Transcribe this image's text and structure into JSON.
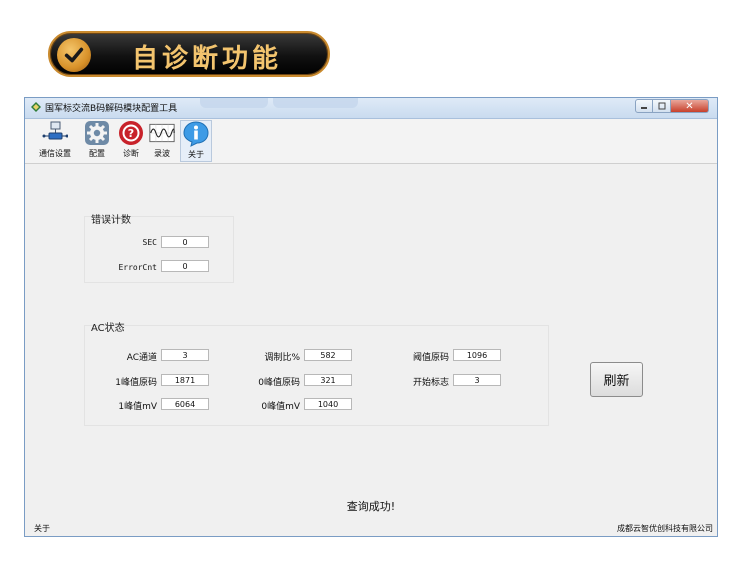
{
  "banner": {
    "title": "自诊断功能",
    "accent": "#f3c46e"
  },
  "window": {
    "title": "国军标交流B码解码模块配置工具",
    "controls": {
      "minimize_icon": "minimize-icon",
      "maximize_icon": "maximize-icon",
      "close_label": "✕"
    }
  },
  "toolbar": {
    "items": [
      {
        "label": "通信设置",
        "icon": "network-icon"
      },
      {
        "label": "配置",
        "icon": "gear-icon"
      },
      {
        "label": "诊断",
        "icon": "diagnose-icon"
      },
      {
        "label": "录波",
        "icon": "waveform-icon"
      },
      {
        "label": "关于",
        "icon": "info-icon"
      }
    ]
  },
  "error_group": {
    "title": "错误计数",
    "fields": [
      {
        "label": "SEC",
        "value": "0"
      },
      {
        "label": "ErrorCnt",
        "value": "0"
      }
    ]
  },
  "ac_group": {
    "title": "AC状态",
    "fields": {
      "ac_channel": {
        "label": "AC通道",
        "value": "3"
      },
      "peak1_raw": {
        "label": "1峰值原码",
        "value": "1871"
      },
      "peak1_mv": {
        "label": "1峰值mV",
        "value": "6064"
      },
      "mod_ratio": {
        "label": "调制比%",
        "value": "582"
      },
      "peak0_raw": {
        "label": "0峰值原码",
        "value": "321"
      },
      "peak0_mv": {
        "label": "0峰值mV",
        "value": "1040"
      },
      "threshold_raw": {
        "label": "阈值原码",
        "value": "1096"
      },
      "start_flag": {
        "label": "开始标志",
        "value": "3"
      }
    }
  },
  "refresh_label": "刷新",
  "status_message": "查询成功!",
  "statusbar": {
    "left": "关于",
    "right": "成都云智优创科技有限公司"
  }
}
